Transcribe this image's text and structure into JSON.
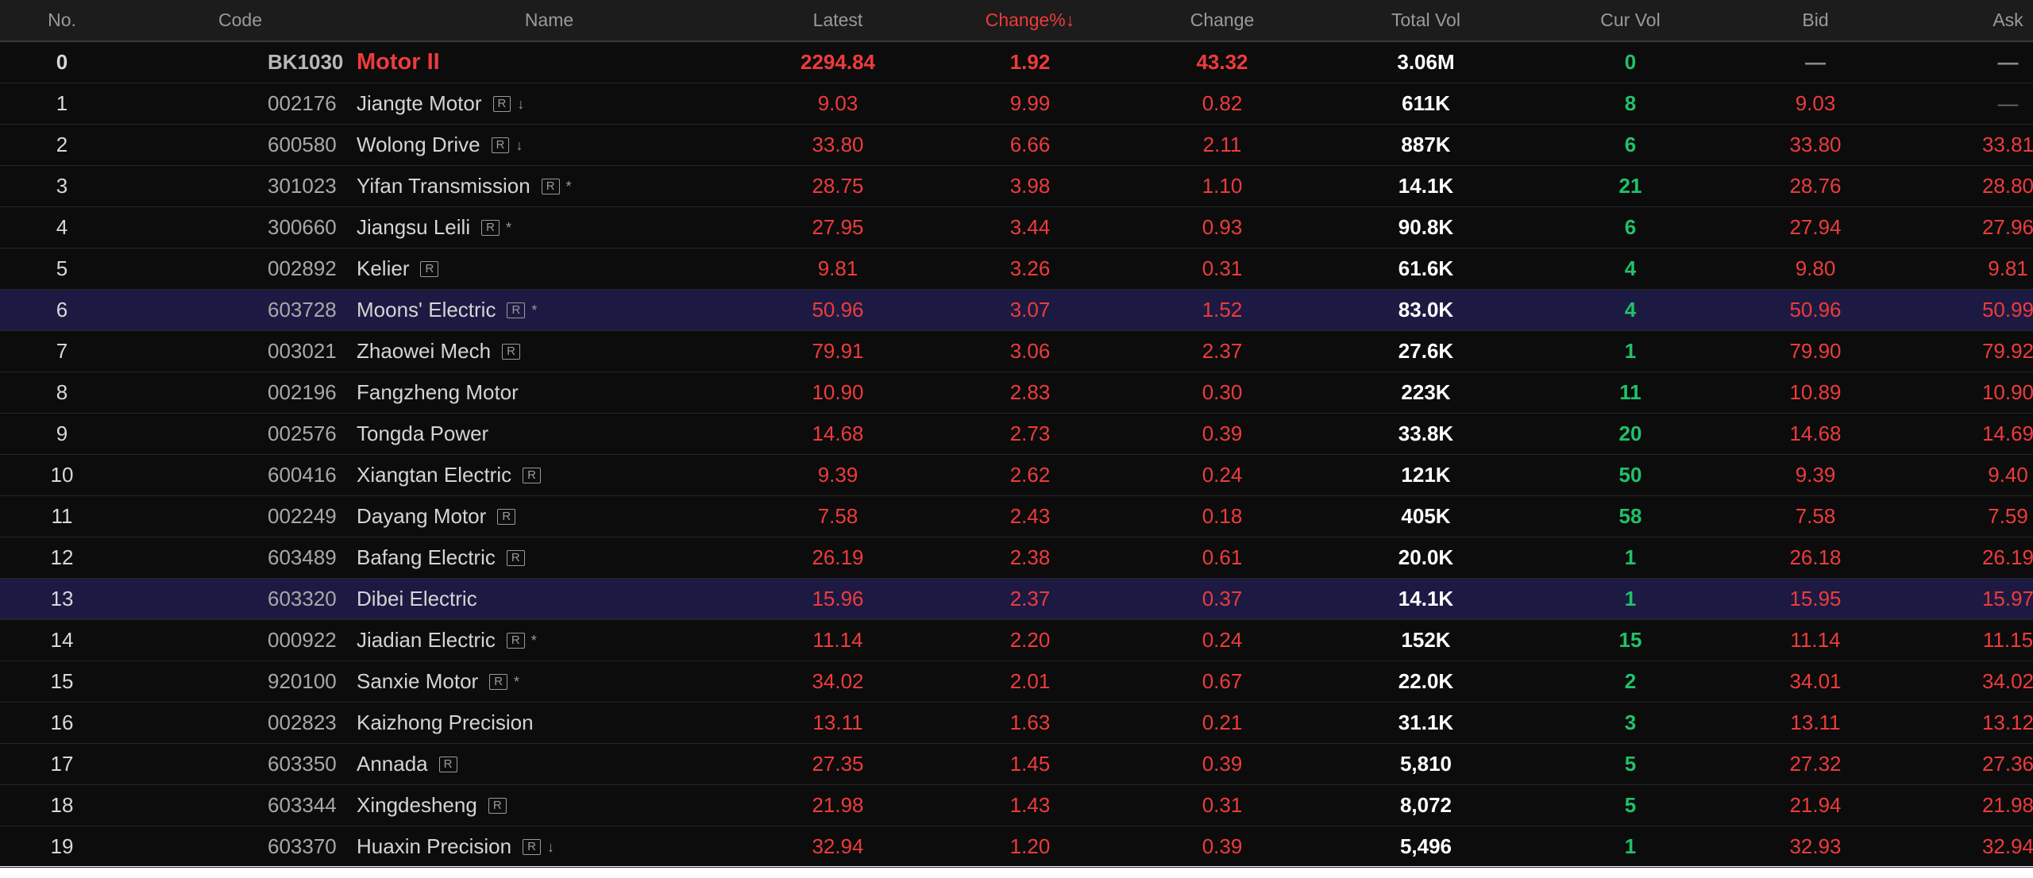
{
  "headers": {
    "no": "No.",
    "code": "Code",
    "name": "Name",
    "latest": "Latest",
    "change_pct": "Change%↓",
    "change": "Change",
    "total_vol": "Total Vol",
    "cur_vol": "Cur Vol",
    "bid": "Bid",
    "ask": "Ask"
  },
  "colors": {
    "up": "#ee3b3b",
    "volume": "#1fc269",
    "highlight_row": "#1c1a42",
    "background": "#0c0c0c"
  },
  "rows": [
    {
      "no": "0",
      "code": "BK1030",
      "name": "Motor II",
      "tag": "",
      "mark": "",
      "latest": "2294.84",
      "change_pct": "1.92",
      "change": "43.32",
      "total_vol": "3.06M",
      "cur_vol": "0",
      "bid": "—",
      "ask": "—"
    },
    {
      "no": "1",
      "code": "002176",
      "name": "Jiangte Motor",
      "tag": "R",
      "mark": "↓",
      "latest": "9.03",
      "change_pct": "9.99",
      "change": "0.82",
      "total_vol": "611K",
      "cur_vol": "8",
      "bid": "9.03",
      "ask": "—"
    },
    {
      "no": "2",
      "code": "600580",
      "name": "Wolong Drive",
      "tag": "R",
      "mark": "↓",
      "latest": "33.80",
      "change_pct": "6.66",
      "change": "2.11",
      "total_vol": "887K",
      "cur_vol": "6",
      "bid": "33.80",
      "ask": "33.81"
    },
    {
      "no": "3",
      "code": "301023",
      "name": "Yifan Transmission",
      "tag": "R",
      "mark": "*",
      "latest": "28.75",
      "change_pct": "3.98",
      "change": "1.10",
      "total_vol": "14.1K",
      "cur_vol": "21",
      "bid": "28.76",
      "ask": "28.80"
    },
    {
      "no": "4",
      "code": "300660",
      "name": "Jiangsu Leili",
      "tag": "R",
      "mark": "*",
      "latest": "27.95",
      "change_pct": "3.44",
      "change": "0.93",
      "total_vol": "90.8K",
      "cur_vol": "6",
      "bid": "27.94",
      "ask": "27.96"
    },
    {
      "no": "5",
      "code": "002892",
      "name": "Kelier",
      "tag": "R",
      "mark": "",
      "latest": "9.81",
      "change_pct": "3.26",
      "change": "0.31",
      "total_vol": "61.6K",
      "cur_vol": "4",
      "bid": "9.80",
      "ask": "9.81"
    },
    {
      "no": "6",
      "code": "603728",
      "name": "Moons' Electric",
      "tag": "R",
      "mark": "*",
      "latest": "50.96",
      "change_pct": "3.07",
      "change": "1.52",
      "total_vol": "83.0K",
      "cur_vol": "4",
      "bid": "50.96",
      "ask": "50.99"
    },
    {
      "no": "7",
      "code": "003021",
      "name": "Zhaowei Mech",
      "tag": "R",
      "mark": "",
      "latest": "79.91",
      "change_pct": "3.06",
      "change": "2.37",
      "total_vol": "27.6K",
      "cur_vol": "1",
      "bid": "79.90",
      "ask": "79.92"
    },
    {
      "no": "8",
      "code": "002196",
      "name": "Fangzheng Motor",
      "tag": "",
      "mark": "",
      "latest": "10.90",
      "change_pct": "2.83",
      "change": "0.30",
      "total_vol": "223K",
      "cur_vol": "11",
      "bid": "10.89",
      "ask": "10.90"
    },
    {
      "no": "9",
      "code": "002576",
      "name": "Tongda Power",
      "tag": "",
      "mark": "",
      "latest": "14.68",
      "change_pct": "2.73",
      "change": "0.39",
      "total_vol": "33.8K",
      "cur_vol": "20",
      "bid": "14.68",
      "ask": "14.69"
    },
    {
      "no": "10",
      "code": "600416",
      "name": "Xiangtan Electric",
      "tag": "R",
      "mark": "",
      "latest": "9.39",
      "change_pct": "2.62",
      "change": "0.24",
      "total_vol": "121K",
      "cur_vol": "50",
      "bid": "9.39",
      "ask": "9.40"
    },
    {
      "no": "11",
      "code": "002249",
      "name": "Dayang Motor",
      "tag": "R",
      "mark": "",
      "latest": "7.58",
      "change_pct": "2.43",
      "change": "0.18",
      "total_vol": "405K",
      "cur_vol": "58",
      "bid": "7.58",
      "ask": "7.59"
    },
    {
      "no": "12",
      "code": "603489",
      "name": "Bafang Electric",
      "tag": "R",
      "mark": "",
      "latest": "26.19",
      "change_pct": "2.38",
      "change": "0.61",
      "total_vol": "20.0K",
      "cur_vol": "1",
      "bid": "26.18",
      "ask": "26.19"
    },
    {
      "no": "13",
      "code": "603320",
      "name": "Dibei Electric",
      "tag": "",
      "mark": "",
      "latest": "15.96",
      "change_pct": "2.37",
      "change": "0.37",
      "total_vol": "14.1K",
      "cur_vol": "1",
      "bid": "15.95",
      "ask": "15.97"
    },
    {
      "no": "14",
      "code": "000922",
      "name": "Jiadian Electric",
      "tag": "R",
      "mark": "*",
      "latest": "11.14",
      "change_pct": "2.20",
      "change": "0.24",
      "total_vol": "152K",
      "cur_vol": "15",
      "bid": "11.14",
      "ask": "11.15"
    },
    {
      "no": "15",
      "code": "920100",
      "name": "Sanxie Motor",
      "tag": "R",
      "mark": "*",
      "latest": "34.02",
      "change_pct": "2.01",
      "change": "0.67",
      "total_vol": "22.0K",
      "cur_vol": "2",
      "bid": "34.01",
      "ask": "34.02"
    },
    {
      "no": "16",
      "code": "002823",
      "name": "Kaizhong Precision",
      "tag": "",
      "mark": "",
      "latest": "13.11",
      "change_pct": "1.63",
      "change": "0.21",
      "total_vol": "31.1K",
      "cur_vol": "3",
      "bid": "13.11",
      "ask": "13.12"
    },
    {
      "no": "17",
      "code": "603350",
      "name": "Annada",
      "tag": "R",
      "mark": "",
      "latest": "27.35",
      "change_pct": "1.45",
      "change": "0.39",
      "total_vol": "5,810",
      "cur_vol": "5",
      "bid": "27.32",
      "ask": "27.36"
    },
    {
      "no": "18",
      "code": "603344",
      "name": "Xingdesheng",
      "tag": "R",
      "mark": "",
      "latest": "21.98",
      "change_pct": "1.43",
      "change": "0.31",
      "total_vol": "8,072",
      "cur_vol": "5",
      "bid": "21.94",
      "ask": "21.98"
    },
    {
      "no": "19",
      "code": "603370",
      "name": "Huaxin Precision",
      "tag": "R",
      "mark": "↓",
      "latest": "32.94",
      "change_pct": "1.20",
      "change": "0.39",
      "total_vol": "5,496",
      "cur_vol": "1",
      "bid": "32.93",
      "ask": "32.94"
    }
  ],
  "highlighted_rows": [
    6,
    13
  ]
}
